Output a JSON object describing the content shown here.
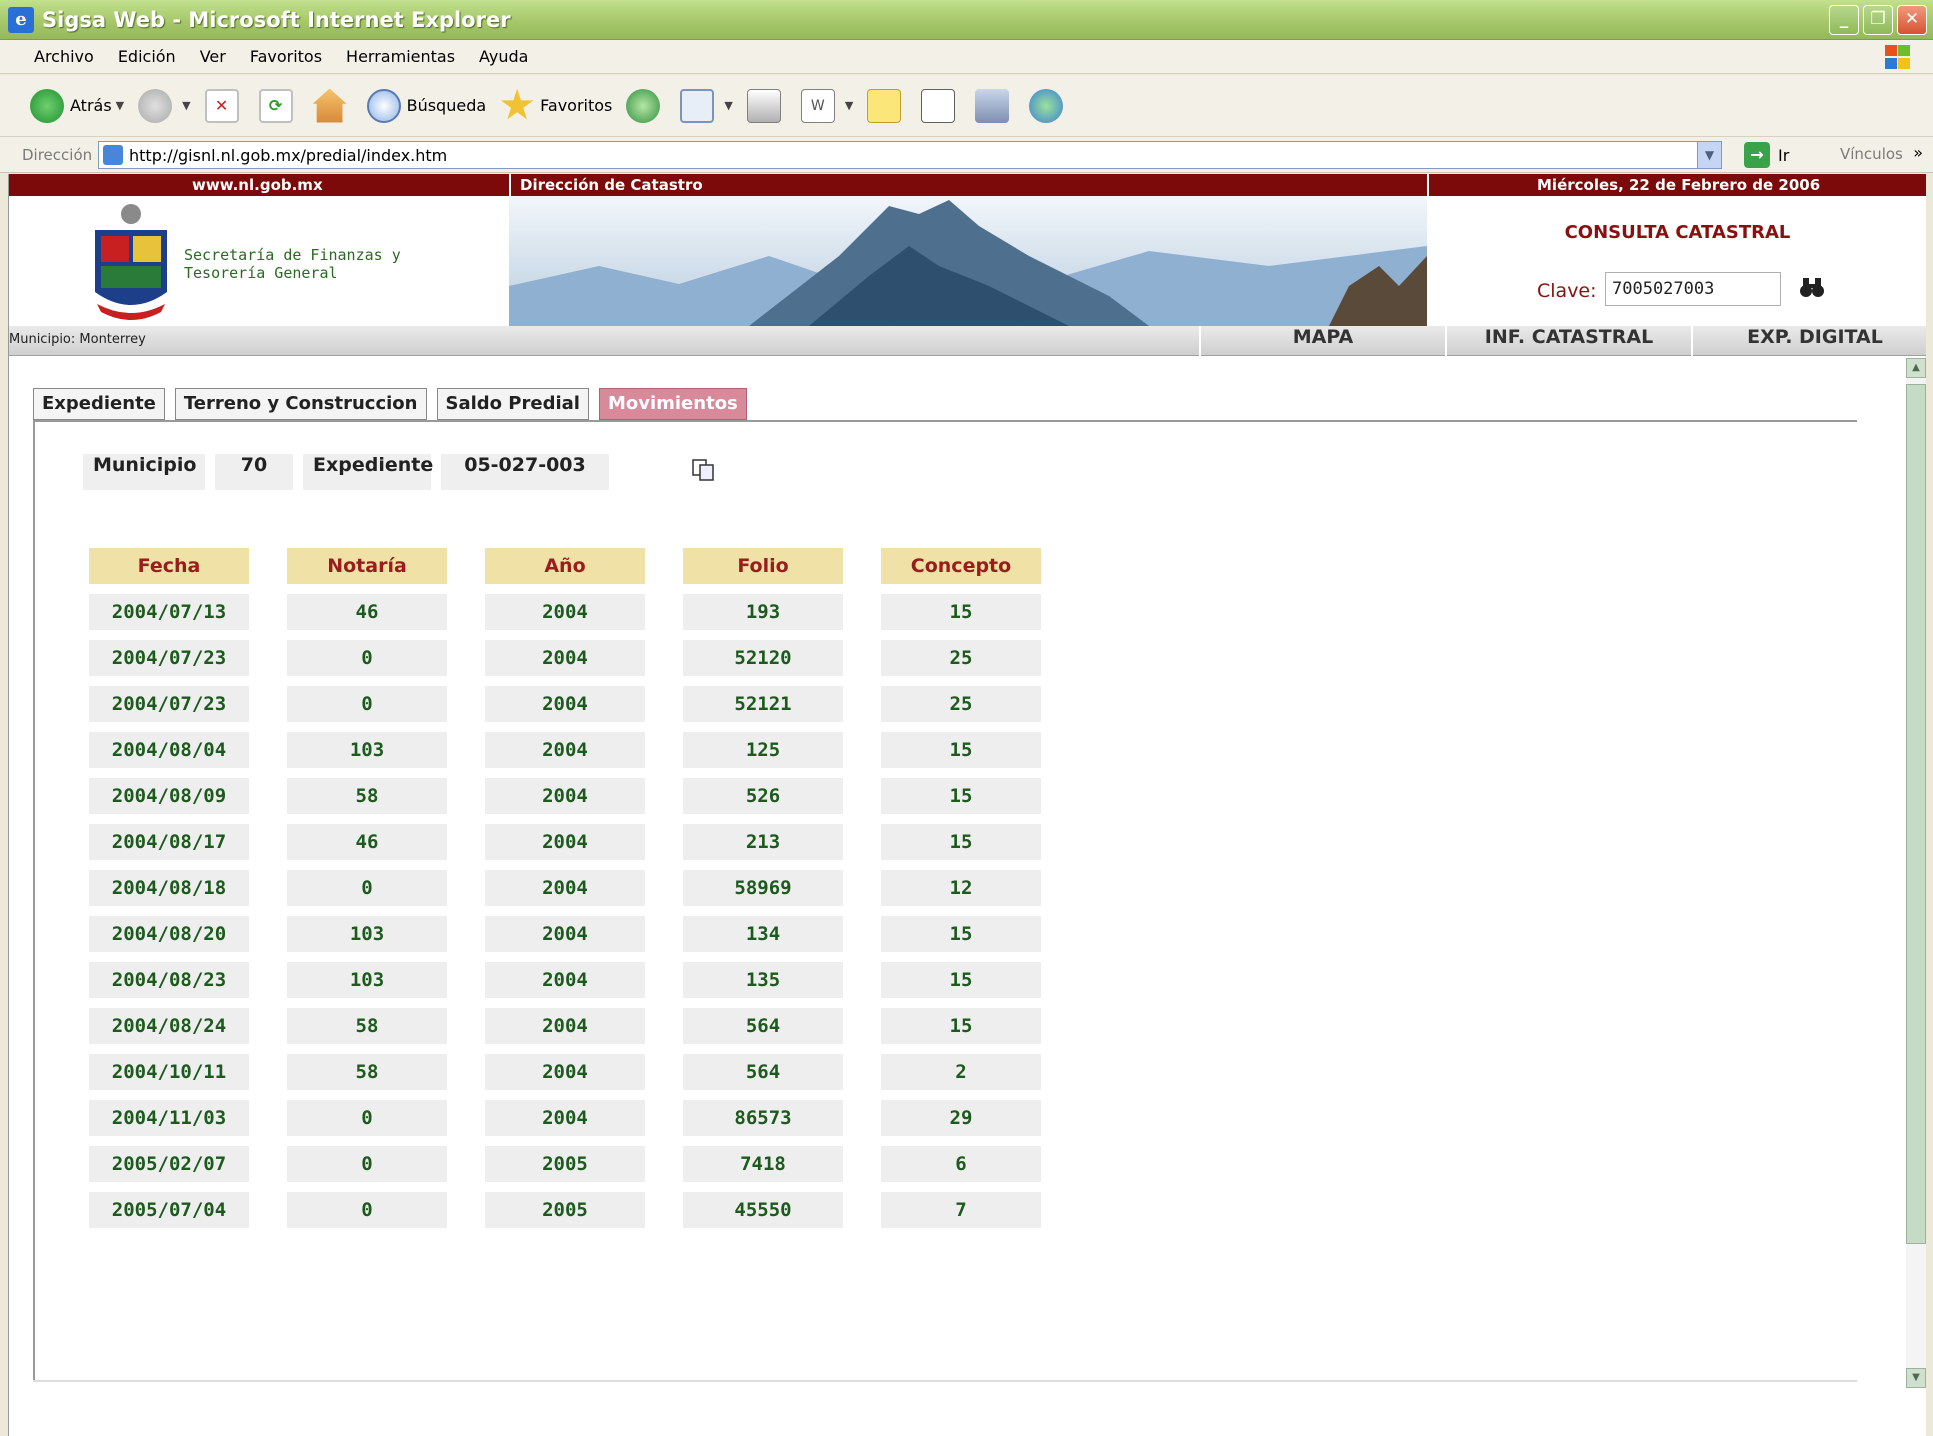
{
  "window": {
    "title": "Sigsa Web - Microsoft Internet Explorer"
  },
  "menu": [
    "Archivo",
    "Edición",
    "Ver",
    "Favoritos",
    "Herramientas",
    "Ayuda"
  ],
  "toolbar": {
    "back_label": "Atrás",
    "search_label": "Búsqueda",
    "favorites_label": "Favoritos"
  },
  "address": {
    "label": "Dirección",
    "url": "http://gisnl.nl.gob.mx/predial/index.htm",
    "go_label": "Ir",
    "links_label": "Vínculos"
  },
  "site": {
    "band_left": "www.nl.gob.mx",
    "band_mid": "Dirección de Catastro",
    "band_date": "Miércoles, 22 de Febrero de 2006",
    "org_name": "Secretaría de Finanzas y Tesorería General",
    "consulta_title": "CONSULTA CATASTRAL",
    "clave_label": "Clave:",
    "clave_value": "7005027003",
    "municipio_label": "Municipio: Monterrey"
  },
  "nav": [
    "MAPA",
    "INF. CATASTRAL",
    "EXP. DIGITAL"
  ],
  "tabs": [
    "Expediente",
    "Terreno y Construccion",
    "Saldo Predial",
    "Movimientos"
  ],
  "info": {
    "municipio_label": "Municipio",
    "municipio_value": "70",
    "expediente_label": "Expediente",
    "expediente_value": "05-027-003"
  },
  "table": {
    "headers": [
      "Fecha",
      "Notaría",
      "Año",
      "Folio",
      "Concepto"
    ],
    "rows": [
      [
        "2004/07/13",
        "46",
        "2004",
        "193",
        "15"
      ],
      [
        "2004/07/23",
        "0",
        "2004",
        "52120",
        "25"
      ],
      [
        "2004/07/23",
        "0",
        "2004",
        "52121",
        "25"
      ],
      [
        "2004/08/04",
        "103",
        "2004",
        "125",
        "15"
      ],
      [
        "2004/08/09",
        "58",
        "2004",
        "526",
        "15"
      ],
      [
        "2004/08/17",
        "46",
        "2004",
        "213",
        "15"
      ],
      [
        "2004/08/18",
        "0",
        "2004",
        "58969",
        "12"
      ],
      [
        "2004/08/20",
        "103",
        "2004",
        "134",
        "15"
      ],
      [
        "2004/08/23",
        "103",
        "2004",
        "135",
        "15"
      ],
      [
        "2004/08/24",
        "58",
        "2004",
        "564",
        "15"
      ],
      [
        "2004/10/11",
        "58",
        "2004",
        "564",
        "2"
      ],
      [
        "2004/11/03",
        "0",
        "2004",
        "86573",
        "29"
      ],
      [
        "2005/02/07",
        "0",
        "2005",
        "7418",
        "6"
      ],
      [
        "2005/07/04",
        "0",
        "2005",
        "45550",
        "7"
      ]
    ]
  }
}
